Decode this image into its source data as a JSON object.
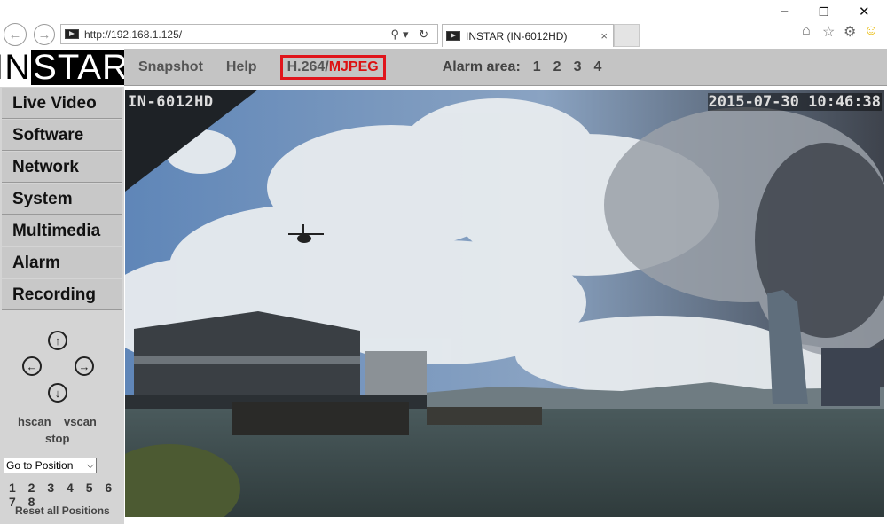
{
  "browser": {
    "url": "http://192.168.1.125/",
    "tab_title": "INSTAR (IN-6012HD)",
    "tab_close": "×",
    "window": {
      "minimize": "–",
      "restore": "❐",
      "close": "✕"
    },
    "toolbar_icons": [
      "home-icon",
      "star-icon",
      "gear-icon",
      "smiley-icon"
    ]
  },
  "logo": {
    "part1": "IN",
    "part2": "STAR"
  },
  "header": {
    "snapshot": "Snapshot",
    "help": "Help",
    "codec_h264": "H.264/",
    "codec_mjpeg": "MJPEG",
    "alarm_label": "Alarm area:",
    "alarm_areas": [
      "1",
      "2",
      "3",
      "4"
    ]
  },
  "sidebar": {
    "items": [
      "Live Video",
      "Software",
      "Network",
      "System",
      "Multimedia",
      "Alarm",
      "Recording"
    ]
  },
  "ptz": {
    "hscan": "hscan",
    "vscan": "vscan",
    "stop": "stop",
    "goto_select": "Go to Position",
    "positions": "1 2 3 4 5 6 7 8",
    "reset": "Reset all Positions"
  },
  "video": {
    "camera_name": "IN-6012HD",
    "timestamp": "2015-07-30 10:46:38"
  },
  "colors": {
    "accent_red": "#e0151c",
    "header_bg": "#c4c4c4",
    "sidebar_bg": "#d4d4d4"
  }
}
